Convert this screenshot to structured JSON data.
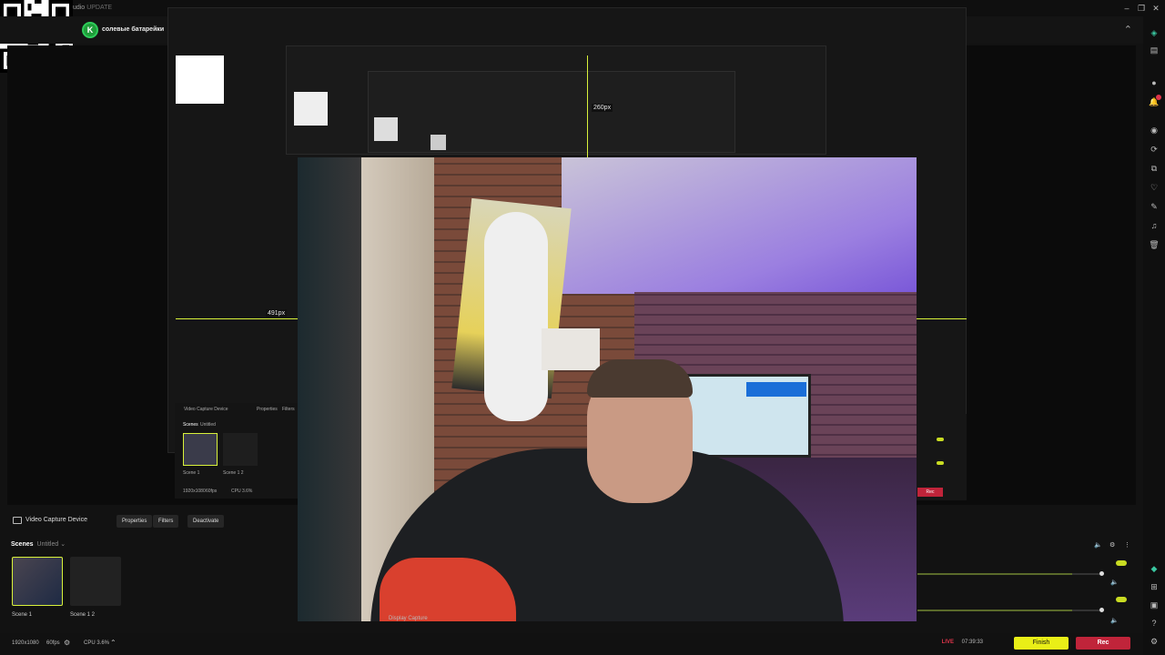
{
  "titlebar": {
    "app_title": "tudio",
    "update_label": "UPDATE",
    "controls": [
      "minimize-icon",
      "restore-icon",
      "close-icon"
    ]
  },
  "header": {
    "channel_name": "солевые батарейки",
    "avatar_letter": "K"
  },
  "canvas": {
    "guide_width_label": "491px",
    "guide_height_label": "260px"
  },
  "source_bar": {
    "source_name": "Video Capture Device",
    "properties_label": "Properties",
    "filters_label": "Filters",
    "deactivate_label": "Deactivate"
  },
  "scenes": {
    "title": "Scenes",
    "collection": "Untitled",
    "items": [
      {
        "label": "Scene 1"
      },
      {
        "label": "Scene 1 2"
      }
    ]
  },
  "nested": {
    "source_name": "Video Capture Device",
    "properties_label": "Properties",
    "filters_label": "Filters",
    "scenes_title": "Scenes",
    "collection": "Untitled",
    "scene1": "Scene 1",
    "scene2": "Scene 1 2",
    "resolution": "1920x1080",
    "fps": "60fps",
    "cpu": "CPU 3.6%",
    "rec_label": "Rec"
  },
  "webcam": {
    "display_label": "Display Capture"
  },
  "status": {
    "resolution": "1920x1080",
    "fps": "60fps",
    "cpu": "CPU 3.6%",
    "live_label": "LIVE",
    "live_time": "07:39:33",
    "finish_label": "Finish",
    "rec_label": "Rec"
  },
  "colors": {
    "accent": "#d9f23a",
    "live": "#e0354b",
    "rec": "#c0243a",
    "finish": "#e9ef17"
  },
  "rail_icons": [
    "studio-mode-icon",
    "layout-icon",
    "chat-icon",
    "notifications-icon",
    "camera-icon",
    "replay-icon",
    "overlay-icon",
    "tips-icon",
    "highlighter-icon",
    "music-icon",
    "delete-icon",
    "prime-icon",
    "app-store-icon",
    "cloud-icon",
    "help-icon",
    "settings-icon"
  ]
}
